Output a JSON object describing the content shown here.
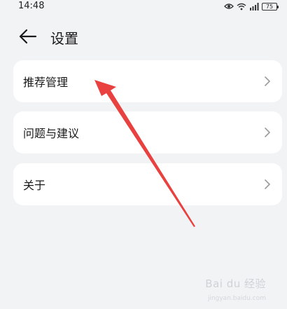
{
  "status_bar": {
    "time": "14:48",
    "battery_level": "75",
    "icons": [
      "eye-icon",
      "wifi-icon",
      "signal-icon",
      "battery-icon"
    ]
  },
  "header": {
    "back_icon": "arrow-left-icon",
    "title": "设置"
  },
  "menu": {
    "items": [
      {
        "label": "推荐管理",
        "icon": "chevron-right-icon"
      },
      {
        "label": "问题与建议",
        "icon": "chevron-right-icon"
      },
      {
        "label": "关于",
        "icon": "chevron-right-icon"
      }
    ]
  },
  "annotation": {
    "color": "#e8413f"
  },
  "watermark": {
    "logo_text": "Bai du 经验",
    "sub_text": "jingyan.baidu.com"
  },
  "colors": {
    "background": "#f1f3f5",
    "card": "#ffffff",
    "text": "#1a1a1a",
    "chevron": "#9a9a9a"
  }
}
